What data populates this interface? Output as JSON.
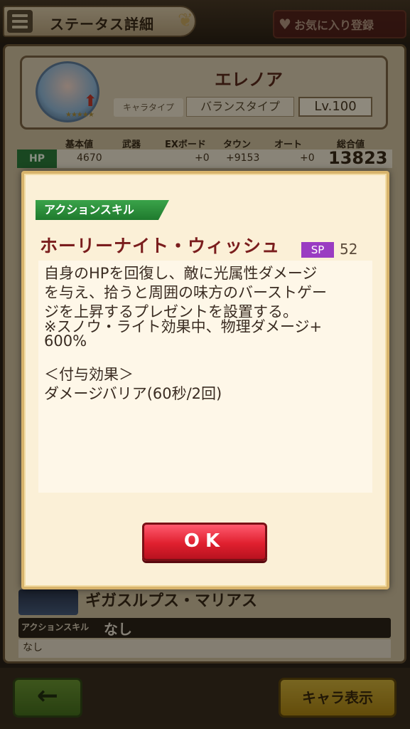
{
  "header": {
    "title": "ステータス詳細",
    "favorite_label": "お気に入り登録"
  },
  "character": {
    "name": "エレノア",
    "type_label": "キャラタイプ",
    "type_value": "バランスタイプ",
    "level": "Lv.100",
    "stars": "★★★★★"
  },
  "stats": {
    "headers": [
      "基本値",
      "武器",
      "EXボード",
      "タウン",
      "オート",
      "総合値"
    ],
    "hp_label": "HP",
    "hp_values": [
      "4670",
      "+0",
      "+9153",
      "+0"
    ],
    "hp_total": "13823"
  },
  "background_skill": {
    "name": "ギガスルプス・マリアス",
    "tag": "アクションスキル",
    "none": "なし",
    "desc": "なし"
  },
  "dialog": {
    "skill_type": "アクションスキル",
    "skill_name": "ホーリーナイト・ウィッシュ",
    "sp_label": "SP",
    "sp_value": "52",
    "description_lines": [
      "自身のHPを回復し、敵に光属性ダメージ",
      "を与え、拾うと周囲の味方のバーストゲー",
      "ジを上昇するプレゼントを設置する。",
      "※スノウ・ライト効果中、物理ダメージ+",
      "600%",
      "",
      "＜付与効果＞",
      "ダメージバリア(60秒/2回)"
    ],
    "ok_label": "OK"
  },
  "footer": {
    "back_icon": "←",
    "chara_button": "キャラ表示"
  },
  "colors": {
    "ok_button": "#e0202f",
    "skill_tag": "#1f7a2e",
    "sp_badge": "#9a3cc2",
    "skill_name": "#7a1d1d"
  }
}
